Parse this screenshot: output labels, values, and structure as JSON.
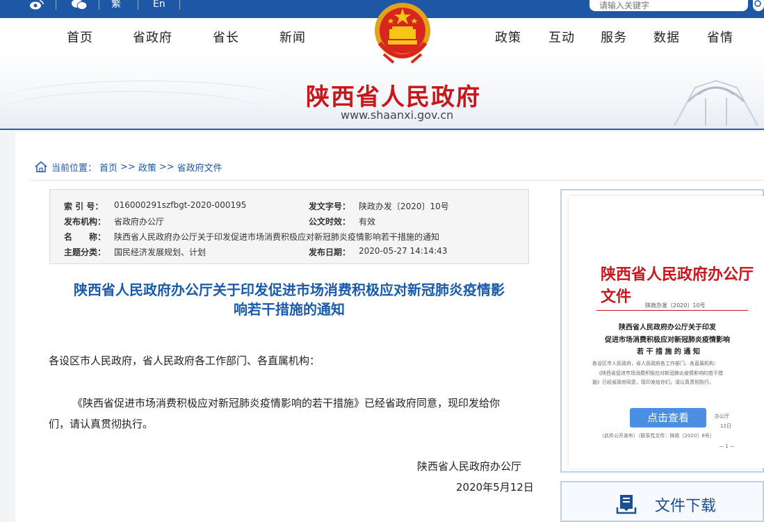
{
  "topbar": {
    "simplified_label": "繁",
    "english_label": "En",
    "search_placeholder": "请输入关键字"
  },
  "nav": {
    "left": [
      "首页",
      "省政府",
      "省长",
      "新闻"
    ],
    "right": [
      "政策",
      "互动",
      "服务",
      "数据",
      "省情"
    ]
  },
  "banner": {
    "title": "陕西省人民政府",
    "url": "www.shaanxi.gov.cn"
  },
  "breadcrumb": {
    "prefix": "当前位置：",
    "items": [
      "首页",
      ">>",
      "政策",
      ">>",
      "省政府文件"
    ]
  },
  "info": {
    "index_label": "索 引 号：",
    "index_value": "016000291szfbgt-2020-000195",
    "doc_no_label": "发文字号：",
    "doc_no_value": "陕政办发〔2020〕10号",
    "issuer_label": "发布机构：",
    "issuer_value": "省政府办公厅",
    "validity_label": "公文时效：",
    "validity_value": "有效",
    "name_label": "名　　称：",
    "name_value": "陕西省人民政府办公厅关于印发促进市场消费积极应对新冠肺炎疫情影响若干措施的通知",
    "topic_label": "主题分类：",
    "topic_value": "国民经济发展规划、计划",
    "date_label": "发布日期：",
    "date_value": "2020-05-27 14:14:43"
  },
  "document": {
    "title_line1": "陕西省人民政府办公厅关于印发促进市场消费积极应对新冠肺炎疫情影",
    "title_line2": "响若干措施的通知",
    "salutation": "各设区市人民政府，省人民政府各工作部门、各直属机构：",
    "body_line1": "《陕西省促进市场消费积极应对新冠肺炎疫情影响的若干措施》已经省政府同意，现印发给你",
    "body_line2": "们，请认真贯彻执行。",
    "signature": "陕西省人民政府办公厅",
    "date": "2020年5月12日"
  },
  "preview": {
    "header": "陕西省人民政府办公厅文件",
    "doc_no": "陕政办发〔2020〕10号",
    "title1": "陕西省人民政府办公厅关于印发",
    "title2": "促进市场消费积极应对新冠肺炎疫情影响",
    "title3": "若 干 措 施 的 通 知",
    "small1": "各设区市人民政府，省人民政府各工作部门、各直属机构：",
    "small2": "《陕西省促进市场消费积极应对新冠肺炎疫情影响的若干措",
    "small3": "施》已经省政府同意，现印发给你们，请认真贯彻执行。",
    "small4": "办公厅",
    "small5": "12日",
    "small6": "（此件公开发布）（联系性文件：陕政〔2020〕8号）",
    "page": "— 1 —",
    "view_button": "点击查看"
  },
  "download": {
    "label": "文件下载"
  },
  "colors": {
    "primary_blue": "#1e57a6",
    "title_red": "#c8161d",
    "doc_title_blue": "#1a5aa8",
    "button_blue": "#4b8fe2"
  }
}
